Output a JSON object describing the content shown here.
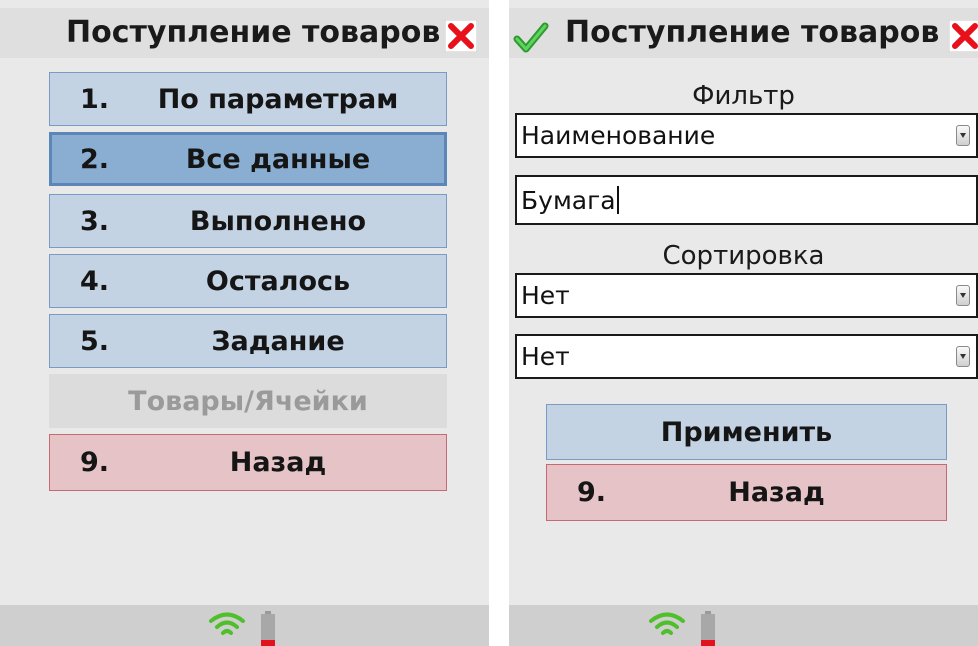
{
  "left_screen": {
    "title": "Поступление товаров",
    "menu": [
      {
        "num": "1.",
        "label": "По параметрам"
      },
      {
        "num": "2.",
        "label": "Все данные"
      },
      {
        "num": "3.",
        "label": "Выполнено"
      },
      {
        "num": "4.",
        "label": "Осталось"
      },
      {
        "num": "5.",
        "label": "Задание"
      }
    ],
    "disabled_item": "Товары/Ячейки",
    "back": {
      "num": "9.",
      "label": "Назад"
    }
  },
  "right_screen": {
    "title": "Поступление товаров",
    "filter_label": "Фильтр",
    "filter_field": "Наименование",
    "filter_value": "Бумага",
    "sort_label": "Сортировка",
    "sort_1": "Нет",
    "sort_2": "Нет",
    "apply_label": "Применить",
    "back": {
      "num": "9.",
      "label": "Назад"
    }
  },
  "colors": {
    "button_blue": "#c3d3e4",
    "selected_blue": "#8aaed2",
    "back_red": "#e6c3c6",
    "close_red": "#e8101a",
    "ok_green": "#39b339",
    "wifi_green": "#4fbf2a"
  },
  "icons": {
    "close": "close-icon",
    "ok": "checkmark-icon",
    "wifi": "wifi-icon",
    "battery": "battery-icon"
  }
}
